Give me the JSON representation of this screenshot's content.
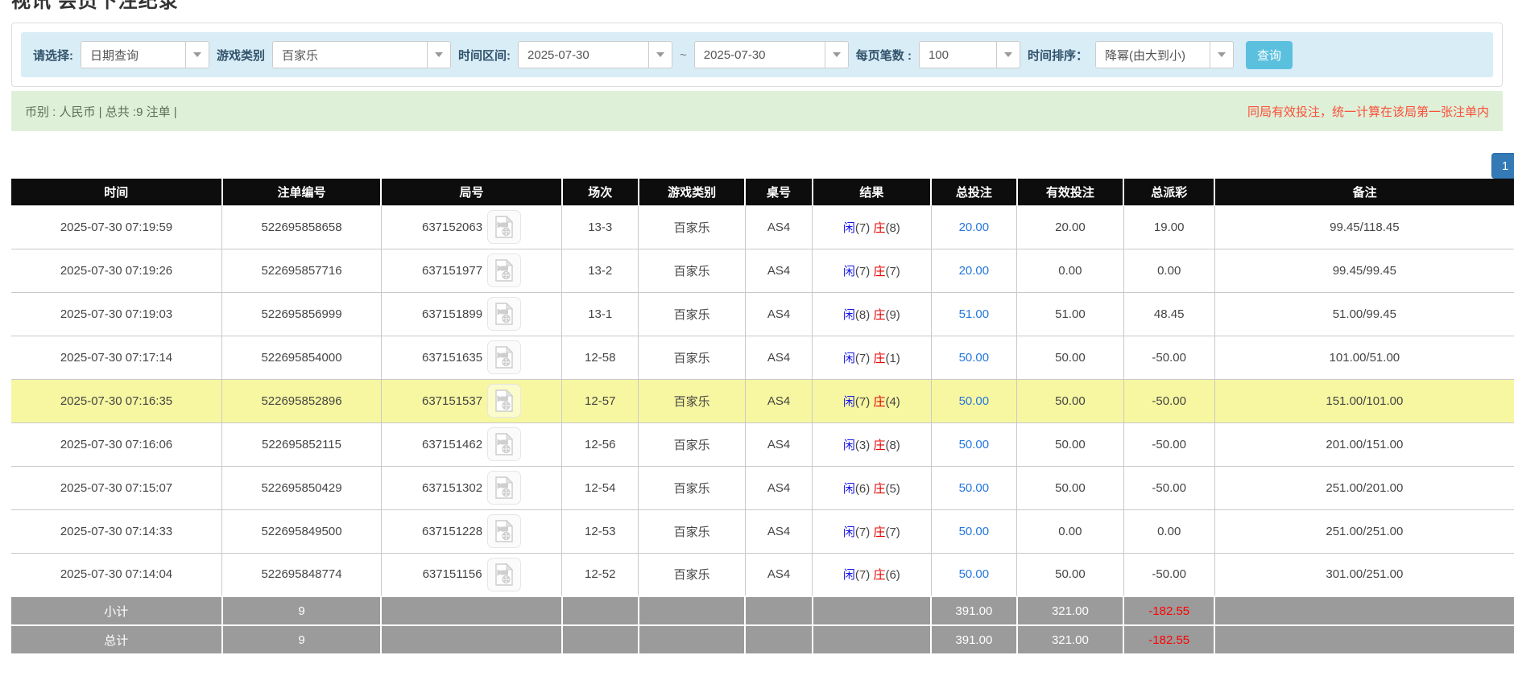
{
  "page": {
    "title": "视讯 会员下注纪录"
  },
  "filters": {
    "select_label": "请选择:",
    "select_value": "日期查询",
    "game_type_label": "游戏类别",
    "game_type_value": "百家乐",
    "date_range_label": "时间区间:",
    "date_from": "2025-07-30",
    "date_separator": "~",
    "date_to": "2025-07-30",
    "page_size_label": "每页笔数 :",
    "page_size_value": "100",
    "sort_label": "时间排序：",
    "sort_value": "降幂(由大到小)",
    "search_button": "查询"
  },
  "summary": {
    "left_text": "币别 : 人民币 | 总共 :9 注单 |",
    "right_note": "同局有效投注，统一计算在该局第一张注单内"
  },
  "pagination": {
    "current_page": "1"
  },
  "icons": {
    "dropdown": "caret-down-icon",
    "replay": "video-replay-icon"
  },
  "table": {
    "headers": [
      "时间",
      "注单编号",
      "局号",
      "场次",
      "游戏类别",
      "桌号",
      "结果",
      "总投注",
      "有效投注",
      "总派彩",
      "备注"
    ],
    "rows": [
      {
        "time": "2025-07-30 07:19:59",
        "bet_id": "522695858658",
        "round_id": "637152063",
        "session": "13-3",
        "game": "百家乐",
        "table_no": "AS4",
        "player": "闲",
        "player_score": "(7)",
        "banker": "庄",
        "banker_score": "(8)",
        "total_bet": "20.00",
        "valid_bet": "20.00",
        "payout": "19.00",
        "remark": "99.45/118.45",
        "highlight": false
      },
      {
        "time": "2025-07-30 07:19:26",
        "bet_id": "522695857716",
        "round_id": "637151977",
        "session": "13-2",
        "game": "百家乐",
        "table_no": "AS4",
        "player": "闲",
        "player_score": "(7)",
        "banker": "庄",
        "banker_score": "(7)",
        "total_bet": "20.00",
        "valid_bet": "0.00",
        "payout": "0.00",
        "remark": "99.45/99.45",
        "highlight": false
      },
      {
        "time": "2025-07-30 07:19:03",
        "bet_id": "522695856999",
        "round_id": "637151899",
        "session": "13-1",
        "game": "百家乐",
        "table_no": "AS4",
        "player": "闲",
        "player_score": "(8)",
        "banker": "庄",
        "banker_score": "(9)",
        "total_bet": "51.00",
        "valid_bet": "51.00",
        "payout": "48.45",
        "remark": "51.00/99.45",
        "highlight": false
      },
      {
        "time": "2025-07-30 07:17:14",
        "bet_id": "522695854000",
        "round_id": "637151635",
        "session": "12-58",
        "game": "百家乐",
        "table_no": "AS4",
        "player": "闲",
        "player_score": "(7)",
        "banker": "庄",
        "banker_score": "(1)",
        "total_bet": "50.00",
        "valid_bet": "50.00",
        "payout": "-50.00",
        "remark": "101.00/51.00",
        "highlight": false
      },
      {
        "time": "2025-07-30 07:16:35",
        "bet_id": "522695852896",
        "round_id": "637151537",
        "session": "12-57",
        "game": "百家乐",
        "table_no": "AS4",
        "player": "闲",
        "player_score": "(7)",
        "banker": "庄",
        "banker_score": "(4)",
        "total_bet": "50.00",
        "valid_bet": "50.00",
        "payout": "-50.00",
        "remark": "151.00/101.00",
        "highlight": true
      },
      {
        "time": "2025-07-30 07:16:06",
        "bet_id": "522695852115",
        "round_id": "637151462",
        "session": "12-56",
        "game": "百家乐",
        "table_no": "AS4",
        "player": "闲",
        "player_score": "(3)",
        "banker": "庄",
        "banker_score": "(8)",
        "total_bet": "50.00",
        "valid_bet": "50.00",
        "payout": "-50.00",
        "remark": "201.00/151.00",
        "highlight": false
      },
      {
        "time": "2025-07-30 07:15:07",
        "bet_id": "522695850429",
        "round_id": "637151302",
        "session": "12-54",
        "game": "百家乐",
        "table_no": "AS4",
        "player": "闲",
        "player_score": "(6)",
        "banker": "庄",
        "banker_score": "(5)",
        "total_bet": "50.00",
        "valid_bet": "50.00",
        "payout": "-50.00",
        "remark": "251.00/201.00",
        "highlight": false
      },
      {
        "time": "2025-07-30 07:14:33",
        "bet_id": "522695849500",
        "round_id": "637151228",
        "session": "12-53",
        "game": "百家乐",
        "table_no": "AS4",
        "player": "闲",
        "player_score": "(7)",
        "banker": "庄",
        "banker_score": "(7)",
        "total_bet": "50.00",
        "valid_bet": "0.00",
        "payout": "0.00",
        "remark": "251.00/251.00",
        "highlight": false
      },
      {
        "time": "2025-07-30 07:14:04",
        "bet_id": "522695848774",
        "round_id": "637151156",
        "session": "12-52",
        "game": "百家乐",
        "table_no": "AS4",
        "player": "闲",
        "player_score": "(7)",
        "banker": "庄",
        "banker_score": "(6)",
        "total_bet": "50.00",
        "valid_bet": "50.00",
        "payout": "-50.00",
        "remark": "301.00/251.00",
        "highlight": false
      }
    ],
    "subtotal": {
      "label": "小计",
      "count": "9",
      "total_bet": "391.00",
      "valid_bet": "321.00",
      "payout": "-182.55"
    },
    "total": {
      "label": "总计",
      "count": "9",
      "total_bet": "391.00",
      "valid_bet": "321.00",
      "payout": "-182.55"
    }
  },
  "colors": {
    "header_bg": "#0d0d0d",
    "highlight": "#f7f7a1",
    "subtotal_bg": "#9b9b9b",
    "link_blue": "#2577dd",
    "player_blue": "#1414e8",
    "banker_red": "#e60000",
    "negative_red": "#ff0000",
    "button_blue": "#5bc0de",
    "pagination_blue": "#337ab7",
    "filter_bg": "#d9edf7",
    "summary_bg": "#dff0d8",
    "note_red": "#fa4f3a"
  }
}
